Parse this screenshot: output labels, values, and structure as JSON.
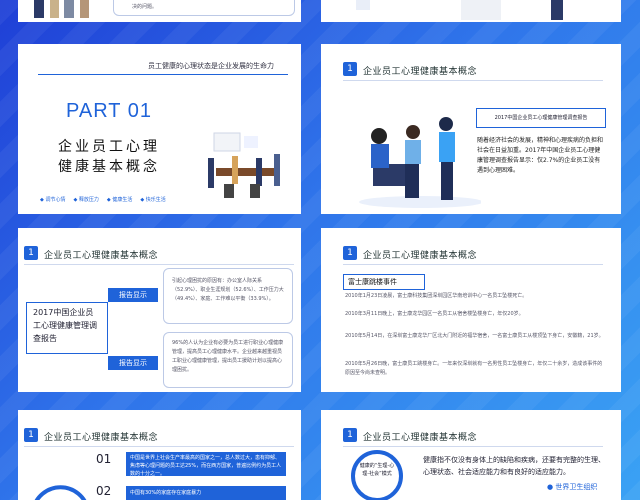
{
  "slide0": {
    "text": "决的问题。"
  },
  "slide2": {
    "tagline": "员工健康的心理状态是企业发展的生命力",
    "part": "PART 01",
    "title_line1": "企业员工心理",
    "title_line2": "健康基本概念",
    "tags": [
      "调节心情",
      "释放压力",
      "健康生活",
      "快乐生活"
    ]
  },
  "slide3": {
    "num": "1",
    "header": "企业员工心理健康基本概念",
    "box_title": "2017中国企业员工心理健康管理调查报告",
    "body": "随着经济社会的发展，精神和心理疾病的负担和社会在日益加重。2017年中国企业员工心理健康管理调查报告显示：仅2.7%的企业员工没有遇到心理困难。"
  },
  "slide4": {
    "num": "1",
    "header": "企业员工心理健康基本概念",
    "left_title": "2017中国企业员工心理健康管理调查报告",
    "label1": "报告显示",
    "label2": "报告显示",
    "text1": "引起心理困扰的原因有：办公室人际关系（52.9%）、职业生涯规划（52.6%）、工作压力大（49.4%）、家庭、工作难以平衡（33.9%）。",
    "text2": "96%的人认为企业有必要为员工进行职业心理健康管理，提高员工心理健康水平。企业越来越重视员工职业心理健康管理，提出员工援助计划以提高心理困扰。"
  },
  "slide5": {
    "num": "1",
    "header": "企业员工心理健康基本概念",
    "event_title": "富士康跳楼事件",
    "events": [
      "2010年1月23日凌晨，富士康科技集团深圳园区华南培训中心一名员工坠楼死亡。",
      "2010年3月11日晚上，富士康龙华园区一名员工从宿舍楼坠楼身亡，年仅20岁。",
      "2010年5月14日，在深圳富士康龙华厂区北大门附近的福华宿舍，一名富士康员工从楼顶坠下身亡，安徽籍，21岁。",
      "2010年5月26日晚，富士康员工跳楼身亡。一年来仅深圳就有一名男性员工坠楼身亡，年仅二十余岁，造成该事件的原因至今尚未查明。"
    ]
  },
  "slide6": {
    "num": "1",
    "header": "企业员工心理健康基本概念",
    "items": [
      {
        "n": "01",
        "text": "中国是世界上社会生产率最高的国家之一，总人数过大，患有抑郁、焦虑等心理问题的员工达25%，而在西方国家，普遍比例约为员工人数的十分之一。"
      },
      {
        "n": "02",
        "text": "中国有30%的家庭存在家庭暴力"
      }
    ]
  },
  "slide7": {
    "num": "1",
    "header": "企业员工心理健康基本概念",
    "circle_text": "健康的“生理-心理-社会”模式",
    "definition": "健康指不仅没有身体上的缺陷和疾病，还要有完整的生理、心理状态、社会适应能力和有良好的适应能力。",
    "org": "世界卫生组织"
  }
}
